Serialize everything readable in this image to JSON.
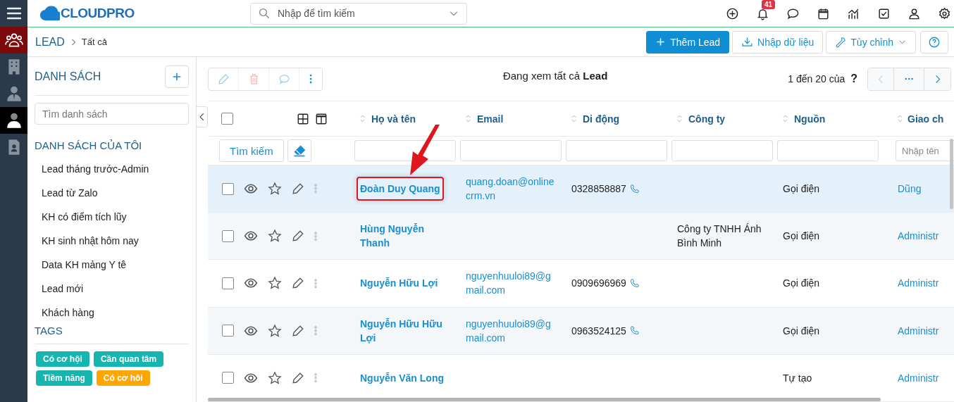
{
  "rail": [
    {
      "kind": "menu",
      "selected": false,
      "hovered": false
    },
    {
      "kind": "leads",
      "selected": true,
      "hovered": false
    },
    {
      "kind": "organizations",
      "selected": false,
      "hovered": false
    },
    {
      "kind": "contacts",
      "selected": false,
      "hovered": false
    },
    {
      "kind": "person",
      "selected": false,
      "hovered": true
    },
    {
      "kind": "document",
      "selected": false,
      "hovered": false
    }
  ],
  "topbar": {
    "logo": "CLOUDPRO",
    "search_placeholder": "Nhập để tìm kiếm",
    "icons": [
      {
        "kind": "add"
      },
      {
        "kind": "bell",
        "badge": "41"
      },
      {
        "kind": "chat"
      },
      {
        "kind": "calendar"
      },
      {
        "kind": "chart"
      },
      {
        "kind": "task"
      },
      {
        "kind": "user"
      },
      {
        "kind": "settings"
      }
    ]
  },
  "breadcrumb": {
    "module": "LEAD",
    "view": "Tất cả"
  },
  "actions": [
    {
      "kind": "add",
      "label": "Thêm Lead"
    },
    {
      "kind": "import",
      "label": "Nhập dữ liệu"
    },
    {
      "kind": "customize",
      "label": "Tùy chỉnh"
    },
    {
      "kind": "help"
    }
  ],
  "lists_panel": {
    "title": "DANH SÁCH",
    "search_placeholder": "Tìm danh sách",
    "my_lists_title": "DANH SÁCH CỦA TÔI",
    "my_lists": [
      "Lead tháng trước-Admin",
      "Lead từ Zalo",
      "KH có điểm tích lũy",
      "KH sinh nhật hôm nay",
      "Data KH mảng Y tê",
      "Lead mới",
      "Khách hàng"
    ],
    "tags_title": "TAGS",
    "tags": [
      {
        "label": "Có cơ hội",
        "color": "#17b5b0"
      },
      {
        "label": "Cần quan tâm",
        "color": "#17b5b0"
      },
      {
        "label": "Tiềm năng",
        "color": "#17b5b0"
      },
      {
        "label": "Có cơ hôi",
        "color": "#ffa600"
      }
    ]
  },
  "list_toolbar": [
    {
      "kind": "edit",
      "disabled": true
    },
    {
      "kind": "delete",
      "disabled": true
    },
    {
      "kind": "comment",
      "disabled": true
    },
    {
      "kind": "more",
      "disabled": false
    }
  ],
  "view_caption": "Đang xem tất cả **Lead**",
  "pagination": {
    "range": "1 đến 20 của",
    "total": "?",
    "prev_disabled": true,
    "next_disabled": false
  },
  "table": {
    "search_button": "Tìm kiếm",
    "select_all_checked": false,
    "columns": [
      {
        "label": "Họ và tên"
      },
      {
        "label": "Email"
      },
      {
        "label": "Di động"
      },
      {
        "label": "Công ty"
      },
      {
        "label": "Nguồn"
      },
      {
        "label": "Giao ch",
        "filter_placeholder": "Nhập tên"
      }
    ],
    "rows": [
      {
        "checked": false,
        "hovered": true,
        "annotated": true,
        "name": "Đoàn Duy Quang",
        "email": "quang.doan@onlinecrm.vn",
        "mobile": "0328858887",
        "source": "Gọi điện",
        "assigned_to": "Dũng"
      },
      {
        "checked": false,
        "hovered": false,
        "annotated": false,
        "name": "Hùng Nguyễn Thanh",
        "company": "Công ty TNHH Ánh Bình Minh",
        "source": "Gọi điện",
        "assigned_to": "Administr"
      },
      {
        "checked": false,
        "hovered": false,
        "annotated": false,
        "name": "Nguyễn Hữu Lợi",
        "email": "nguyenhuuloi89@gmail.com",
        "mobile": "0909696969",
        "source": "Gọi điện",
        "assigned_to": "Administr"
      },
      {
        "checked": false,
        "hovered": false,
        "annotated": false,
        "name": "Nguyễn Hữu Hữu Lợi",
        "email": "nguyenhuuloi89@gmail.com",
        "mobile": "0963524125",
        "source": "Gọi điện",
        "assigned_to": "Administr"
      },
      {
        "checked": false,
        "hovered": false,
        "annotated": false,
        "name": "Nguyễn Văn Long",
        "source": "Tự tạo",
        "assigned_to": "Administr"
      }
    ]
  }
}
